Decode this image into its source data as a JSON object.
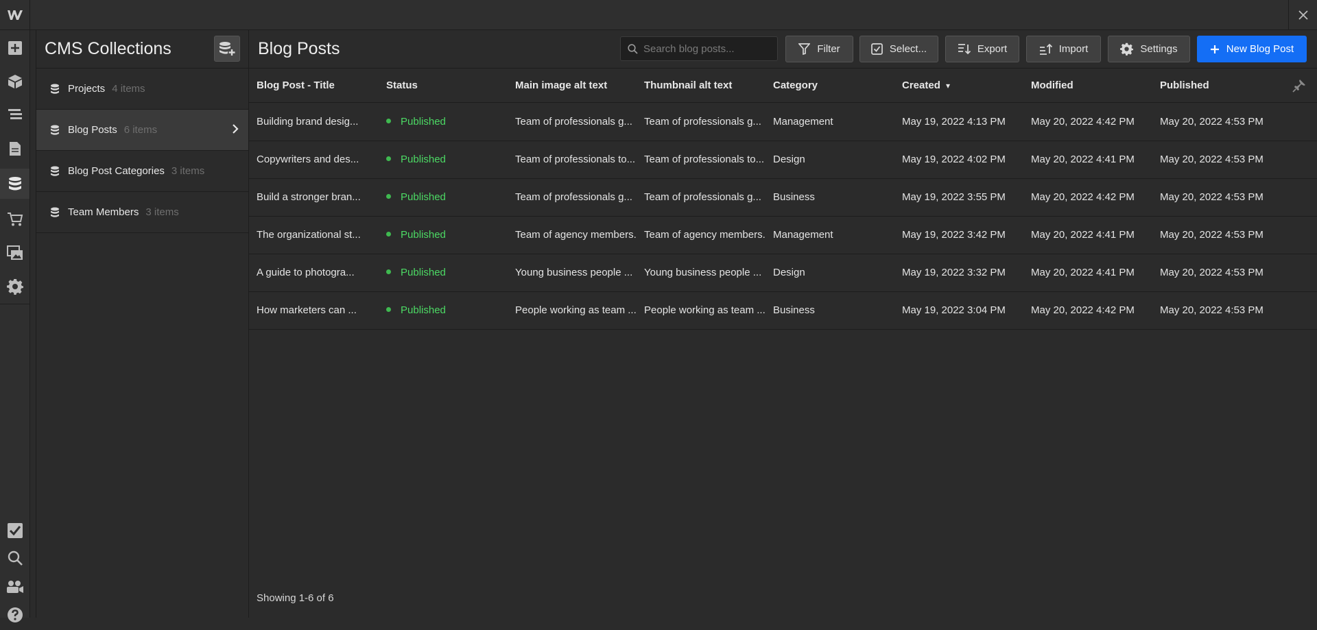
{
  "app": {
    "logo_text": "W",
    "logo_color": "#cfcfcf"
  },
  "rail": {
    "top_items": [
      "add-icon",
      "components-icon",
      "navigator-icon",
      "pages-icon",
      "cms-icon",
      "ecommerce-icon",
      "assets-icon",
      "settings-icon"
    ],
    "bottom_items": [
      "tasks-icon",
      "search-icon",
      "users-icon",
      "help-icon"
    ]
  },
  "collections": {
    "title": "CMS Collections",
    "items": [
      {
        "name": "Projects",
        "count": "4 items"
      },
      {
        "name": "Blog Posts",
        "count": "6 items"
      },
      {
        "name": "Blog Post Categories",
        "count": "3 items"
      },
      {
        "name": "Team Members",
        "count": "3 items"
      }
    ]
  },
  "main": {
    "title": "Blog Posts",
    "search_placeholder": "Search blog posts...",
    "toolbar": {
      "filter": "Filter",
      "select": "Select...",
      "export": "Export",
      "import": "Import",
      "settings": "Settings",
      "new": "New Blog Post"
    },
    "columns": [
      "Blog Post - Title",
      "Status",
      "Main image alt text",
      "Thumbnail alt text",
      "Category",
      "Created",
      "Modified",
      "Published"
    ],
    "sort_indicator": "▾",
    "rows": [
      {
        "title": "Building brand desig...",
        "status": "Published",
        "main_alt": "Team of professionals g...",
        "thumb_alt": "Team of professionals g...",
        "category": "Management",
        "created": "May 19, 2022 4:13 PM",
        "modified": "May 20, 2022 4:42 PM",
        "published": "May 20, 2022 4:53 PM"
      },
      {
        "title": "Copywriters and des...",
        "status": "Published",
        "main_alt": "Team of professionals to...",
        "thumb_alt": "Team of professionals to...",
        "category": "Design",
        "created": "May 19, 2022 4:02 PM",
        "modified": "May 20, 2022 4:41 PM",
        "published": "May 20, 2022 4:53 PM"
      },
      {
        "title": "Build a stronger bran...",
        "status": "Published",
        "main_alt": "Team of professionals g...",
        "thumb_alt": "Team of professionals g...",
        "category": "Business",
        "created": "May 19, 2022 3:55 PM",
        "modified": "May 20, 2022 4:42 PM",
        "published": "May 20, 2022 4:53 PM"
      },
      {
        "title": "The organizational st...",
        "status": "Published",
        "main_alt": "Team of agency members.",
        "thumb_alt": "Team of agency members.",
        "category": "Management",
        "created": "May 19, 2022 3:42 PM",
        "modified": "May 20, 2022 4:41 PM",
        "published": "May 20, 2022 4:53 PM"
      },
      {
        "title": "A guide to photogra...",
        "status": "Published",
        "main_alt": "Young business people ...",
        "thumb_alt": "Young business people ...",
        "category": "Design",
        "created": "May 19, 2022 3:32 PM",
        "modified": "May 20, 2022 4:41 PM",
        "published": "May 20, 2022 4:53 PM"
      },
      {
        "title": "How marketers can ...",
        "status": "Published",
        "main_alt": "People working as team ...",
        "thumb_alt": "People working as team ...",
        "category": "Business",
        "created": "May 19, 2022 3:04 PM",
        "modified": "May 20, 2022 4:42 PM",
        "published": "May 20, 2022 4:53 PM"
      }
    ],
    "footer": "Showing 1-6 of 6"
  },
  "colors": {
    "accent": "#146ef5",
    "status_published": "#4cd964",
    "background": "#2b2b2b"
  }
}
